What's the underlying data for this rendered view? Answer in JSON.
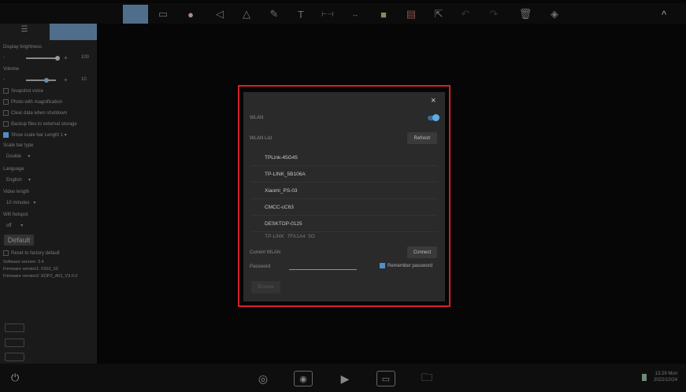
{
  "toolbar": {
    "tools": [
      "select-area",
      "frame",
      "color-wheel",
      "angle",
      "triangle",
      "pencil",
      "text",
      "scale-ruler",
      "measure-line",
      "color-picker",
      "color-bars",
      "pointer",
      "undo",
      "redo",
      "trash",
      "eraser"
    ],
    "collapse": "^"
  },
  "left_panel": {
    "display_brightness": "Display brightness",
    "brightness_value": "100",
    "brightness_level": 1.0,
    "volume": "Volume",
    "volume_value": "10",
    "volume_level": 0.6,
    "checkboxes": [
      {
        "label": "Snapshot voice",
        "checked": false
      },
      {
        "label": "Photo with magnification",
        "checked": false
      },
      {
        "label": "Clear data when shutdown",
        "checked": false
      },
      {
        "label": "Backup files to external storage",
        "checked": false
      },
      {
        "label": "Show scale bar Length",
        "checked": true
      }
    ],
    "scale_len": "1",
    "scale_bar_type_label": "Scale bar type",
    "scale_bar_type": "Double",
    "language_label": "Language",
    "language": "English",
    "video_length_label": "Video length",
    "video_length": "10 minutes",
    "hotspot_label": "Wifi hotspot",
    "hotspot": "off",
    "default_button": "Default",
    "reset_label": "Reset to factory default",
    "software_version": "Software version: 3.4",
    "firmware1": "Firmware version1: 0202_03",
    "firmware2": "Firmware version2: EDP2_A01_V3.0.0"
  },
  "dialog": {
    "close": "×",
    "wlan_label": "WLAN",
    "wlan_on": true,
    "wlan_list_label": "WLAN List",
    "refresh": "Refresh",
    "networks": [
      "TPLink-45G45",
      "TP-LINK_5B106A",
      "Xiaomi_PS-03",
      "CMCC-cC63",
      "DESKTOP-0125",
      "TP-LINK_7FA1A4_5G"
    ],
    "current_wlan_label": "Current WLAN",
    "connect": "Connect",
    "password_label": "Password",
    "password_value": "",
    "remember": "Remember password",
    "remember_checked": true,
    "browse": "Browse"
  },
  "status": {
    "time": "13:29 Mon",
    "date": "2022/10/24"
  },
  "colors": {
    "accent": "#4d8fc7",
    "highlight": "#d4202a"
  }
}
